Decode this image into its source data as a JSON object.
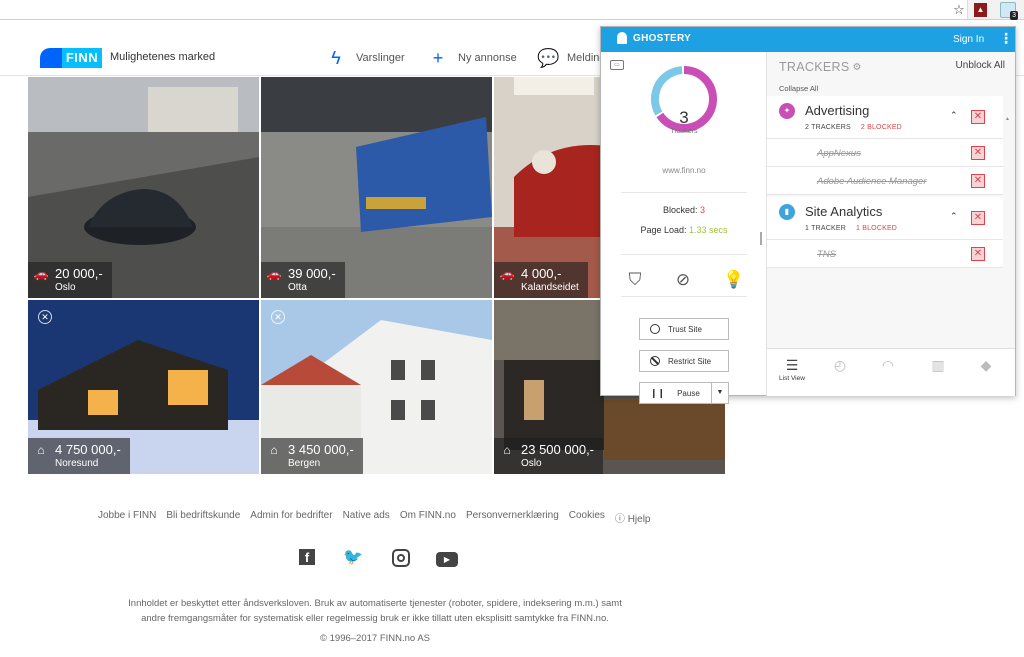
{
  "browser": {
    "icons": [
      "star-icon",
      "pdf-extension-icon",
      "ghostery-extension-icon"
    ],
    "ghostery_badge": "3"
  },
  "header": {
    "logo_text": "FINN",
    "tagline": "Mulighetenes marked",
    "nav": [
      {
        "label": "Varslinger",
        "icon": "bolt-icon"
      },
      {
        "label": "Ny annonse",
        "icon": "plus-icon"
      },
      {
        "label": "Meldinger",
        "icon": "chat-icon"
      }
    ]
  },
  "listings": [
    {
      "price": "20 000,-",
      "location": "Oslo",
      "type": "car",
      "bg": "#5d5d5a"
    },
    {
      "price": "39 000,-",
      "location": "Otta",
      "type": "car",
      "bg": "#6e6e6a"
    },
    {
      "price": "4 000,-",
      "location": "Kalandseidet",
      "type": "car",
      "bg": "#8a4a3a"
    },
    {
      "price": "4 750 000,-",
      "location": "Noresund",
      "type": "home",
      "bg": "#1e3a78"
    },
    {
      "price": "3 450 000,-",
      "location": "Bergen",
      "type": "home",
      "bg": "#c8d2dc"
    },
    {
      "price": "23 500 000,-",
      "location": "Oslo",
      "type": "home",
      "bg": "#3a3632"
    }
  ],
  "footer": {
    "links": [
      "Jobbe i FINN",
      "Bli bedriftskunde",
      "Admin for bedrifter",
      "Native ads",
      "Om FINN.no",
      "Personvernerklæring",
      "Cookies",
      "Hjelp"
    ],
    "legal_line1": "Innholdet er beskyttet etter åndsverksloven. Bruk av automatiserte tjenester (roboter, spidere, indeksering m.m.) samt",
    "legal_line2": "andre fremgangsmåter for systematisk eller regelmessig bruk er ikke tillatt uten eksplisitt samtykke fra FINN.no.",
    "copyright": "© 1996–2017 FINN.no AS"
  },
  "ghostery": {
    "brand": "GHOSTERY",
    "sign_in": "Sign In",
    "tracker_count": "3",
    "tracker_count_label": "Trackers",
    "domain": "www.finn.no",
    "blocked_label": "Blocked:",
    "blocked_value": "3",
    "page_load_label": "Page Load:",
    "page_load_value": "1.33 secs",
    "buttons": {
      "trust": "Trust Site",
      "restrict": "Restrict Site",
      "pause": "Pause"
    },
    "trackers_title": "TRACKERS",
    "unblock_all": "Unblock All",
    "collapse_all": "Collapse All",
    "categories": [
      {
        "name": "Advertising",
        "count": "2 TRACKERS",
        "blocked": "2 BLOCKED",
        "color": "#c94fb6",
        "trackers": [
          "AppNexus",
          "Adobe Audience Manager"
        ]
      },
      {
        "name": "Site Analytics",
        "count": "1 TRACKER",
        "blocked": "1 BLOCKED",
        "color": "#3fa3e0",
        "trackers": [
          "TNS"
        ]
      }
    ],
    "tabs": [
      {
        "label": "List View"
      }
    ],
    "donut": {
      "blocked_fraction": 1.0,
      "colors": [
        "#c94fb6",
        "#7cc8e8"
      ],
      "split": [
        0.667,
        0.333
      ]
    }
  }
}
